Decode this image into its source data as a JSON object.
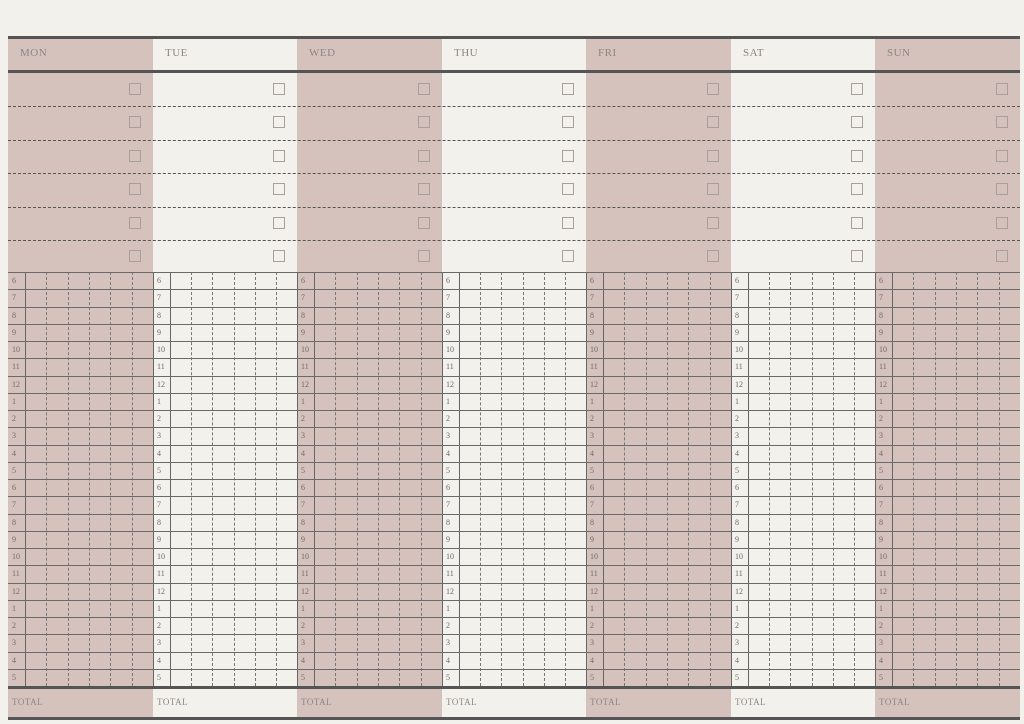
{
  "colors": {
    "accent_pink": "#d6c2bc",
    "paper": "#f3f1ec",
    "rule": "#555555",
    "text": "#8b8585"
  },
  "days": [
    {
      "label": "MON",
      "shade": "pink"
    },
    {
      "label": "TUE",
      "shade": "white"
    },
    {
      "label": "WED",
      "shade": "pink"
    },
    {
      "label": "THU",
      "shade": "white"
    },
    {
      "label": "FRI",
      "shade": "pink"
    },
    {
      "label": "SAT",
      "shade": "white"
    },
    {
      "label": "SUN",
      "shade": "pink"
    }
  ],
  "tasks_per_day": 6,
  "hours": [
    "6",
    "7",
    "8",
    "9",
    "10",
    "11",
    "12",
    "1",
    "2",
    "3",
    "4",
    "5",
    "6",
    "7",
    "8",
    "9",
    "10",
    "11",
    "12",
    "1",
    "2",
    "3",
    "4",
    "5"
  ],
  "subcolumns_per_hour": 6,
  "total_label": "TOTAL"
}
